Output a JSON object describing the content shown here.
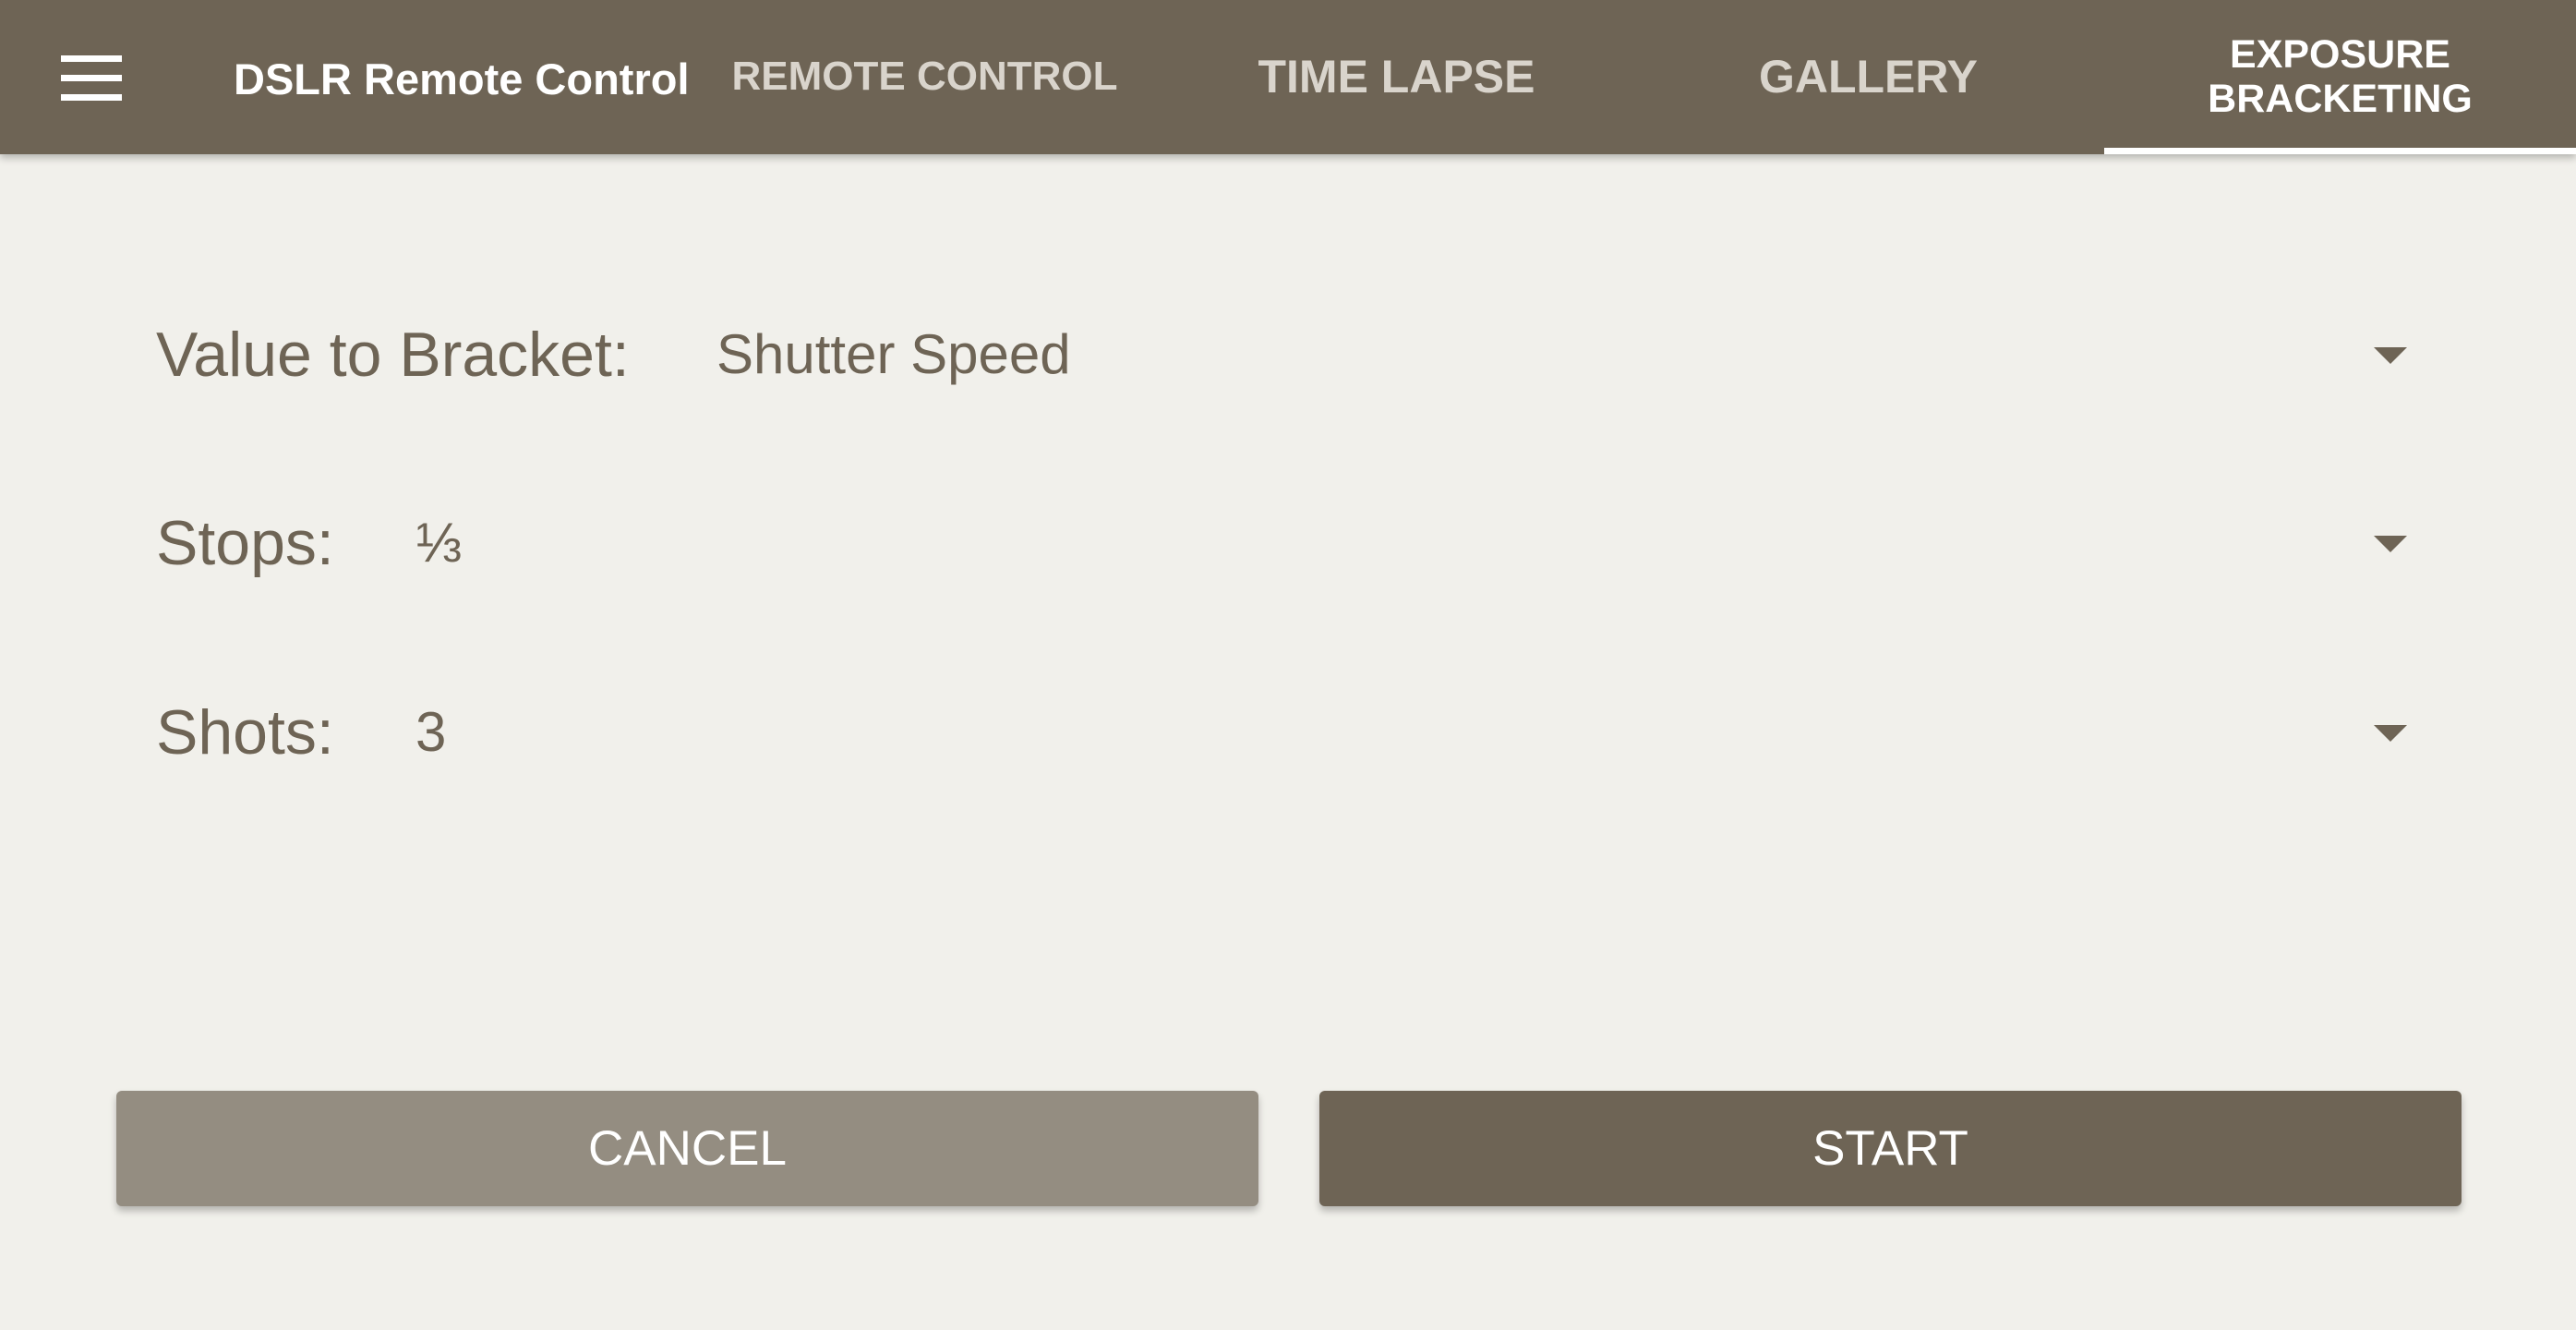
{
  "appbar": {
    "menu_icon": "hamburger-menu-icon",
    "title": "DSLR Remote Control",
    "tabs": [
      {
        "label": "REMOTE CONTROL",
        "active": false
      },
      {
        "label": "TIME LAPSE",
        "active": false
      },
      {
        "label": "GALLERY",
        "active": false
      },
      {
        "label": "EXPOSURE BRACKETING",
        "active": true
      }
    ]
  },
  "form": {
    "fields": [
      {
        "label": "Value to Bracket:",
        "value": "Shutter Speed",
        "icon": "dropdown-arrow-icon"
      },
      {
        "label": "Stops:",
        "value": "⅓",
        "icon": "dropdown-arrow-icon"
      },
      {
        "label": "Shots:",
        "value": "3",
        "icon": "dropdown-arrow-icon"
      }
    ]
  },
  "actions": {
    "cancel_label": "CANCEL",
    "start_label": "START"
  },
  "colors": {
    "primary": "#6e6455",
    "secondary": "#948d81",
    "background": "#f1f0eb",
    "inactive_tab_text": "#d9d4cc"
  }
}
